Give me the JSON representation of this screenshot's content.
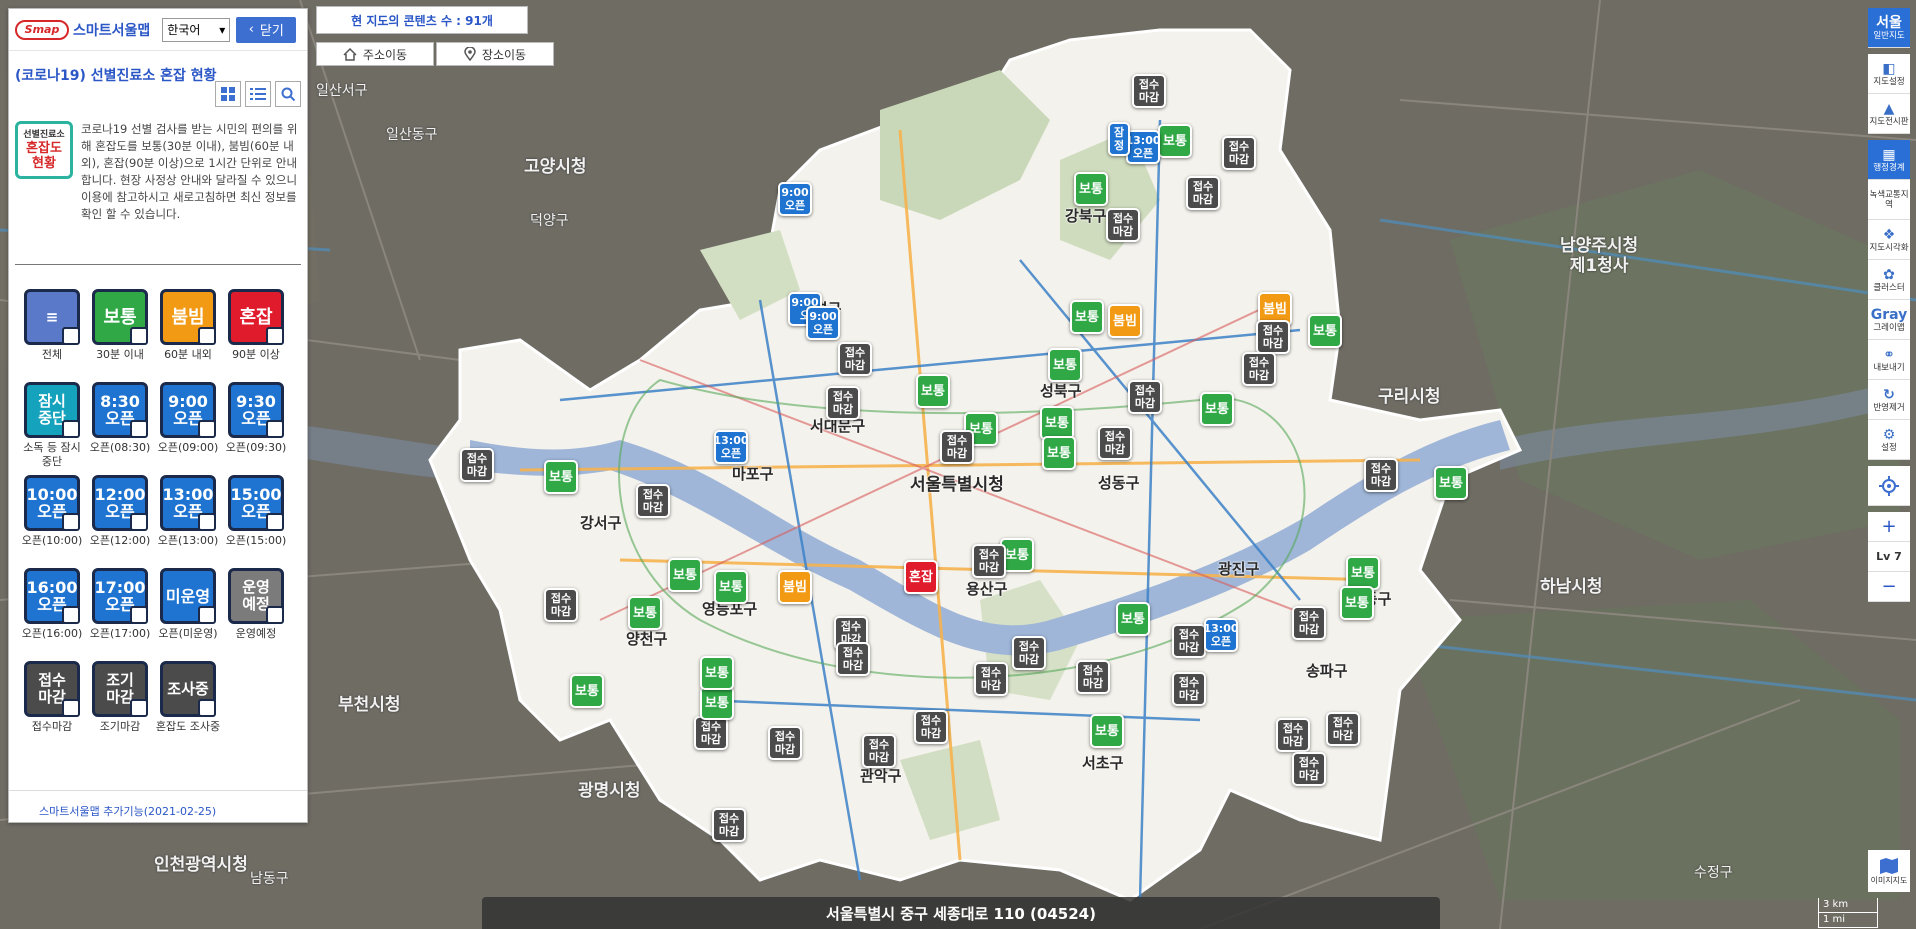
{
  "header": {
    "logo_mark": "Smap",
    "app_name": "스마트서울맵",
    "language": "한국어",
    "close_label": "닫기"
  },
  "panel": {
    "title": "(코로나19) 선별진료소 혼잡 현황",
    "badge_small": "선별진료소",
    "badge_big1": "혼잡도",
    "badge_big2": "현황",
    "description": "코로나19 선별 검사를 받는 시민의 편의를 위해 혼잡도를 보통(30분 이내), 붐빔(60분 내외), 혼잡(90분 이상)으로 1시간 단위로 안내합니다. 현장 사정상 안내와 달라질 수 있으니 이용에 참고하시고 새로고침하면 최신 정보를 확인 할 수 있습니다.",
    "footer": "스마트서울맵 추가기능(2021-02-25)"
  },
  "legend": [
    {
      "icon": "≡",
      "label": "전체",
      "style": "all"
    },
    {
      "icon": "보통",
      "label": "30분 이내",
      "style": "normal"
    },
    {
      "icon": "붐빔",
      "label": "60분 내외",
      "style": "busy"
    },
    {
      "icon": "혼잡",
      "label": "90분 이상",
      "style": "crowd"
    },
    {
      "icon": "잠시\n중단",
      "label": "소독 등 잠시중단",
      "style": "teal"
    },
    {
      "icon": "8:30\n오픈",
      "label": "오픈(08:30)",
      "style": "open"
    },
    {
      "icon": "9:00\n오픈",
      "label": "오픈(09:00)",
      "style": "open"
    },
    {
      "icon": "9:30\n오픈",
      "label": "오픈(09:30)",
      "style": "open"
    },
    {
      "icon": "10:00\n오픈",
      "label": "오픈(10:00)",
      "style": "open"
    },
    {
      "icon": "12:00\n오픈",
      "label": "오픈(12:00)",
      "style": "open"
    },
    {
      "icon": "13:00\n오픈",
      "label": "오픈(13:00)",
      "style": "open"
    },
    {
      "icon": "15:00\n오픈",
      "label": "오픈(15:00)",
      "style": "open"
    },
    {
      "icon": "16:00\n오픈",
      "label": "오픈(16:00)",
      "style": "open"
    },
    {
      "icon": "17:00\n오픈",
      "label": "오픈(17:00)",
      "style": "open"
    },
    {
      "icon": "미운영",
      "label": "오픈(미운영)",
      "style": "open"
    },
    {
      "icon": "운영\n예정",
      "label": "운영예정",
      "style": "gray"
    },
    {
      "icon": "접수\n마감",
      "label": "접수마감",
      "style": "dark"
    },
    {
      "icon": "조기\n마감",
      "label": "조기마감",
      "style": "dark"
    },
    {
      "icon": "조사중",
      "label": "혼잡도 조사중",
      "style": "dark"
    }
  ],
  "counter": "현 지도의 콘텐츠 수 : 91개",
  "move": {
    "address": "주소이동",
    "place": "장소이동"
  },
  "rightbar": [
    {
      "glyph": "서울",
      "label": "일반지도",
      "active": true
    },
    {
      "glyph": "◧",
      "label": "지도설정",
      "active": false
    },
    {
      "glyph": "▲",
      "label": "지도전시판",
      "active": false
    },
    {
      "glyph": "▦",
      "label": "행정경계",
      "active": true
    },
    {
      "glyph": "",
      "label": "녹색교통지역",
      "active": false
    },
    {
      "glyph": "❖",
      "label": "지도시각화",
      "active": false
    },
    {
      "glyph": "✿",
      "label": "클러스터",
      "active": false
    },
    {
      "glyph": "Gray",
      "label": "그레이맵",
      "active": false
    },
    {
      "glyph": "⚭",
      "label": "내보내기",
      "active": false
    },
    {
      "glyph": "↻",
      "label": "반영제거",
      "active": false
    },
    {
      "glyph": "⚙",
      "label": "설정",
      "active": false
    }
  ],
  "zoom": {
    "in": "+",
    "level": "Lv 7",
    "out": "−"
  },
  "map_image_label": "이미지지도",
  "scale": {
    "km": "3 km",
    "mi": "1 mi"
  },
  "address_bar": "서울특별시 중구 세종대로 110 (04524)",
  "places": [
    {
      "name": "서울특별시청",
      "kind": "inside"
    },
    {
      "name": "강북구",
      "kind": "inside"
    },
    {
      "name": "성북구",
      "kind": "inside"
    },
    {
      "name": "은평구",
      "kind": "inside"
    },
    {
      "name": "서대문구",
      "kind": "inside"
    },
    {
      "name": "마포구",
      "kind": "inside"
    },
    {
      "name": "강서구",
      "kind": "inside"
    },
    {
      "name": "양천구",
      "kind": "inside"
    },
    {
      "name": "영등포구",
      "kind": "inside"
    },
    {
      "name": "용산구",
      "kind": "inside"
    },
    {
      "name": "성동구",
      "kind": "inside"
    },
    {
      "name": "광진구",
      "kind": "inside"
    },
    {
      "name": "송파구",
      "kind": "inside"
    },
    {
      "name": "강동구",
      "kind": "inside"
    },
    {
      "name": "서초구",
      "kind": "inside"
    },
    {
      "name": "관악구",
      "kind": "inside"
    },
    {
      "name": "고양시청",
      "kind": "outside"
    },
    {
      "name": "구리시청",
      "kind": "outside"
    },
    {
      "name": "하남시청",
      "kind": "outside"
    },
    {
      "name": "광명시청",
      "kind": "outside"
    },
    {
      "name": "부천시청",
      "kind": "outside"
    },
    {
      "name": "인천광역시청",
      "kind": "outside"
    },
    {
      "name": "남양주시청\n제1청사",
      "kind": "outside"
    },
    {
      "name": "일산서구",
      "kind": "outside-small"
    },
    {
      "name": "일산동구",
      "kind": "outside-small"
    },
    {
      "name": "덕양구",
      "kind": "outside-small"
    },
    {
      "name": "수정구",
      "kind": "outside-small"
    },
    {
      "name": "남동구",
      "kind": "outside-small"
    }
  ],
  "markers": [
    {
      "text": "접수\n마감",
      "type": "closed"
    },
    {
      "text": "보통",
      "type": "normal"
    },
    {
      "text": "13:00\n오픈",
      "type": "open"
    },
    {
      "text": "잠\n정",
      "type": "open"
    },
    {
      "text": "접수\n마감",
      "type": "closed"
    },
    {
      "text": "보통",
      "type": "normal"
    },
    {
      "text": "접수\n마감",
      "type": "closed"
    },
    {
      "text": "접수\n마감",
      "type": "closed"
    },
    {
      "text": "9:00\n오픈",
      "type": "open"
    },
    {
      "text": "9:00\n오",
      "type": "open"
    },
    {
      "text": "9:00\n오픈",
      "type": "open"
    },
    {
      "text": "보통",
      "type": "normal"
    },
    {
      "text": "붐빔",
      "type": "busy"
    },
    {
      "text": "붐빔",
      "type": "busy"
    },
    {
      "text": "접수\n마감",
      "type": "closed"
    },
    {
      "text": "보통",
      "type": "normal"
    },
    {
      "text": "접수\n마감",
      "type": "closed"
    },
    {
      "text": "보통",
      "type": "normal"
    },
    {
      "text": "보통",
      "type": "normal"
    },
    {
      "text": "접수\n마감",
      "type": "closed"
    },
    {
      "text": "보통",
      "type": "normal"
    },
    {
      "text": "보통",
      "type": "normal"
    },
    {
      "text": "13:00\n오픈",
      "type": "open"
    },
    {
      "text": "접수\n마감",
      "type": "closed"
    },
    {
      "text": "보통",
      "type": "normal"
    },
    {
      "text": "접수\n마감",
      "type": "closed"
    },
    {
      "text": "접수\n마감",
      "type": "closed"
    },
    {
      "text": "접수\n마감",
      "type": "closed"
    },
    {
      "text": "보통",
      "type": "normal"
    },
    {
      "text": "접수\n마감",
      "type": "closed"
    },
    {
      "text": "혼잡",
      "type": "crowd"
    },
    {
      "text": "붐빔",
      "type": "busy"
    },
    {
      "text": "보통",
      "type": "normal"
    },
    {
      "text": "보통",
      "type": "normal"
    },
    {
      "text": "접수\n마감",
      "type": "closed"
    },
    {
      "text": "보통",
      "type": "normal"
    },
    {
      "text": "접수\n마감",
      "type": "closed"
    },
    {
      "text": "보통",
      "type": "normal"
    },
    {
      "text": "보통",
      "type": "normal"
    },
    {
      "text": "보통",
      "type": "normal"
    },
    {
      "text": "접수\n마감",
      "type": "closed"
    },
    {
      "text": "접수\n마감",
      "type": "closed"
    },
    {
      "text": "접수\n마감",
      "type": "closed"
    },
    {
      "text": "접수\n마감",
      "type": "closed"
    },
    {
      "text": "접수\n마감",
      "type": "closed"
    },
    {
      "text": "보통",
      "type": "normal"
    },
    {
      "text": "접수\n마감",
      "type": "closed"
    },
    {
      "text": "접수\n마감",
      "type": "closed"
    },
    {
      "text": "접수\n마감",
      "type": "closed"
    },
    {
      "text": "접수\n마감",
      "type": "closed"
    },
    {
      "text": "보통",
      "type": "normal"
    },
    {
      "text": "보통",
      "type": "normal"
    },
    {
      "text": "13:00\n오픈",
      "type": "open"
    },
    {
      "text": "접수\n마감",
      "type": "closed"
    },
    {
      "text": "접수\n마감",
      "type": "closed"
    },
    {
      "text": "보통",
      "type": "normal"
    },
    {
      "text": "접수\n마감",
      "type": "closed"
    },
    {
      "text": "접수\n마감",
      "type": "closed"
    },
    {
      "text": "접수\n마감",
      "type": "closed"
    },
    {
      "text": "보통",
      "type": "normal"
    },
    {
      "text": "보통",
      "type": "normal"
    },
    {
      "text": "접수\n마감",
      "type": "closed"
    },
    {
      "text": "접수\n마감",
      "type": "closed"
    },
    {
      "text": "접수\n마감",
      "type": "closed"
    },
    {
      "text": "접수\n마감",
      "type": "closed"
    },
    {
      "text": "보통",
      "type": "normal"
    }
  ]
}
